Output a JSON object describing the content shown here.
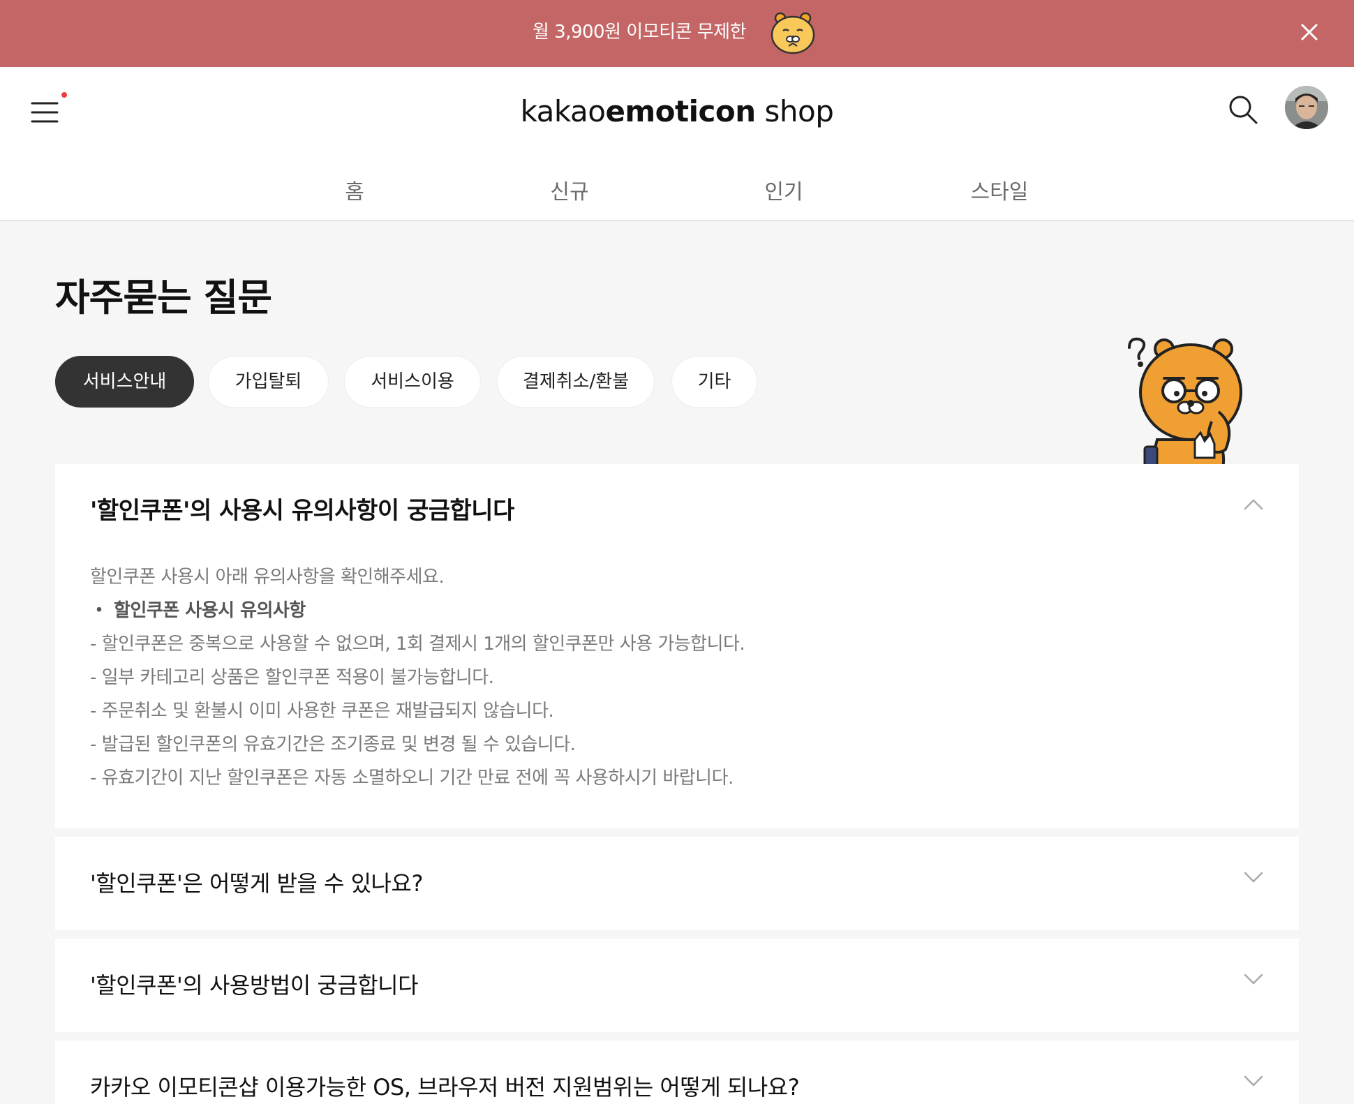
{
  "promo": {
    "text": "월 3,900원 이모티콘 무제한",
    "character_icon": "ryan-face-icon",
    "close_icon": "close-icon",
    "background_color": "#c46666"
  },
  "header": {
    "logo": {
      "part1": "kakao",
      "part2": "emoticon",
      "part3": " shop"
    },
    "menu_icon": "hamburger-menu-icon",
    "search_icon": "search-icon",
    "notification_dot_color": "#f03c3c"
  },
  "nav": {
    "items": [
      {
        "label": "홈"
      },
      {
        "label": "신규"
      },
      {
        "label": "인기"
      },
      {
        "label": "스타일"
      }
    ]
  },
  "page": {
    "title": "자주묻는 질문",
    "tabs": [
      {
        "label": "서비스안내",
        "active": true
      },
      {
        "label": "가입탈퇴",
        "active": false
      },
      {
        "label": "서비스이용",
        "active": false
      },
      {
        "label": "결제취소/환불",
        "active": false
      },
      {
        "label": "기타",
        "active": false
      }
    ]
  },
  "faqs": [
    {
      "question": "'할인쿠폰'의 사용시 유의사항이 궁금합니다",
      "expanded": true,
      "answer": [
        "할인쿠폰 사용시 아래 유의사항을 확인해주세요.",
        "・ 할인쿠폰 사용시 유의사항",
        "- 할인쿠폰은 중복으로 사용할 수 없으며, 1회 결제시 1개의 할인쿠폰만 사용 가능합니다.",
        "- 일부 카테고리 상품은 할인쿠폰 적용이 불가능합니다.",
        "- 주문취소 및 환불시 이미 사용한 쿠폰은 재발급되지 않습니다.",
        "- 발급된 할인쿠폰의 유효기간은 조기종료 및 변경 될 수 있습니다.",
        "- 유효기간이 지난 할인쿠폰은 자동 소멸하오니 기간 만료 전에 꼭 사용하시기 바랍니다."
      ]
    },
    {
      "question": "'할인쿠폰'은 어떻게 받을 수 있나요?",
      "expanded": false
    },
    {
      "question": "'할인쿠폰'의 사용방법이 궁금합니다",
      "expanded": false
    },
    {
      "question": "카카오 이모티콘샵 이용가능한 OS, 브라우저 버전 지원범위는 어떻게 되나요?",
      "expanded": false
    }
  ]
}
